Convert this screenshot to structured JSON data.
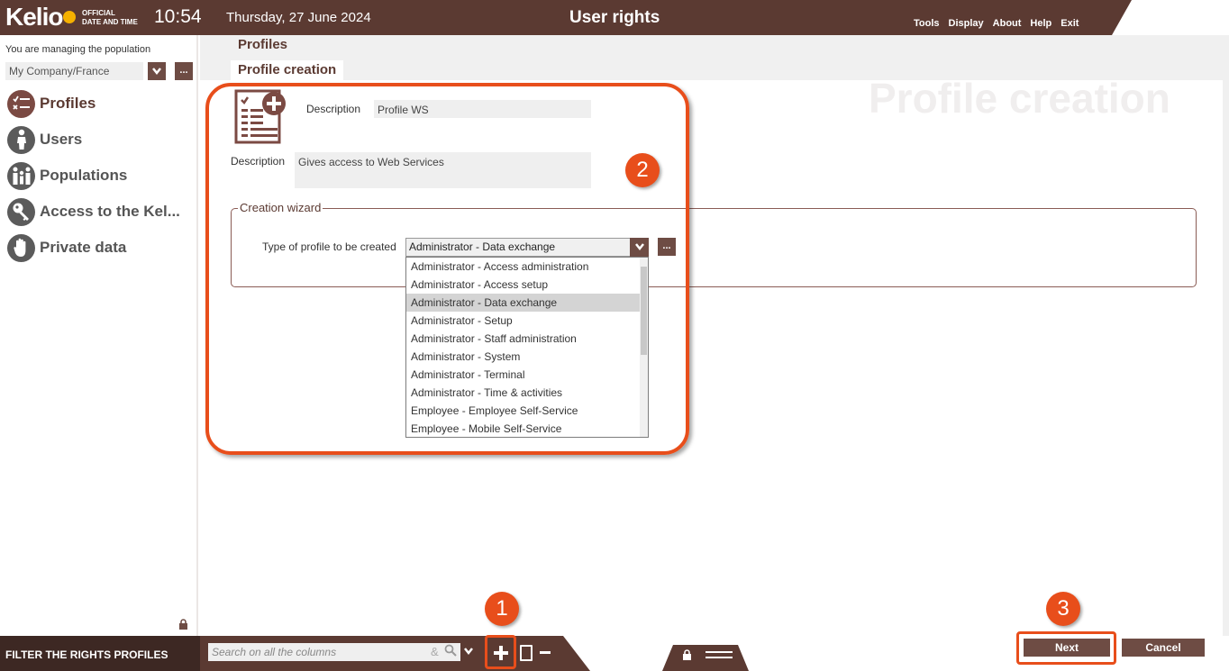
{
  "header": {
    "logo": "Kelio",
    "official_line1": "OFFICIAL",
    "official_line2": "DATE AND TIME",
    "time": "10:54",
    "date": "Thursday, 27 June 2024",
    "title": "User rights",
    "menu": [
      "Tools",
      "Display",
      "About",
      "Help",
      "Exit"
    ]
  },
  "sidebar": {
    "population_label": "You are managing the population",
    "population_value": "My Company/France",
    "more_label": "...",
    "items": [
      {
        "label": "Profiles",
        "icon": "profiles-icon",
        "active": true
      },
      {
        "label": "Users",
        "icon": "user-icon"
      },
      {
        "label": "Populations",
        "icon": "populations-icon"
      },
      {
        "label": "Access to the Kel...",
        "icon": "key-icon"
      },
      {
        "label": "Private data",
        "icon": "hand-icon"
      }
    ]
  },
  "breadcrumb": {
    "section": "Profiles",
    "tab": "Profile creation"
  },
  "main": {
    "watermark": "Profile creation",
    "desc_label_short": "Description",
    "desc_short_value": "Profile WS",
    "desc_label_long": "Description",
    "desc_long_value": "Gives access to Web Services",
    "wizard_legend": "Creation wizard",
    "type_label": "Type of profile to be created",
    "type_selected": "Administrator - Data exchange",
    "type_more": "...",
    "options": [
      "Administrator - Access administration",
      "Administrator - Access setup",
      "Administrator - Data exchange",
      "Administrator - Setup",
      "Administrator - Staff administration",
      "Administrator - System",
      "Administrator - Terminal",
      "Administrator - Time & activities",
      "Employee - Employee Self-Service",
      "Employee - Mobile Self-Service"
    ],
    "selected_index": 2
  },
  "callouts": [
    "1",
    "2",
    "3"
  ],
  "bottombar": {
    "filter_label": "FILTER THE RIGHTS PROFILES",
    "search_placeholder": "Search on all the columns",
    "search_amp": "&",
    "next_label": "Next",
    "cancel_label": "Cancel"
  },
  "colors": {
    "brand": "#5b3a32",
    "accent": "#e84e1b",
    "logo_dot": "#f6b100"
  }
}
